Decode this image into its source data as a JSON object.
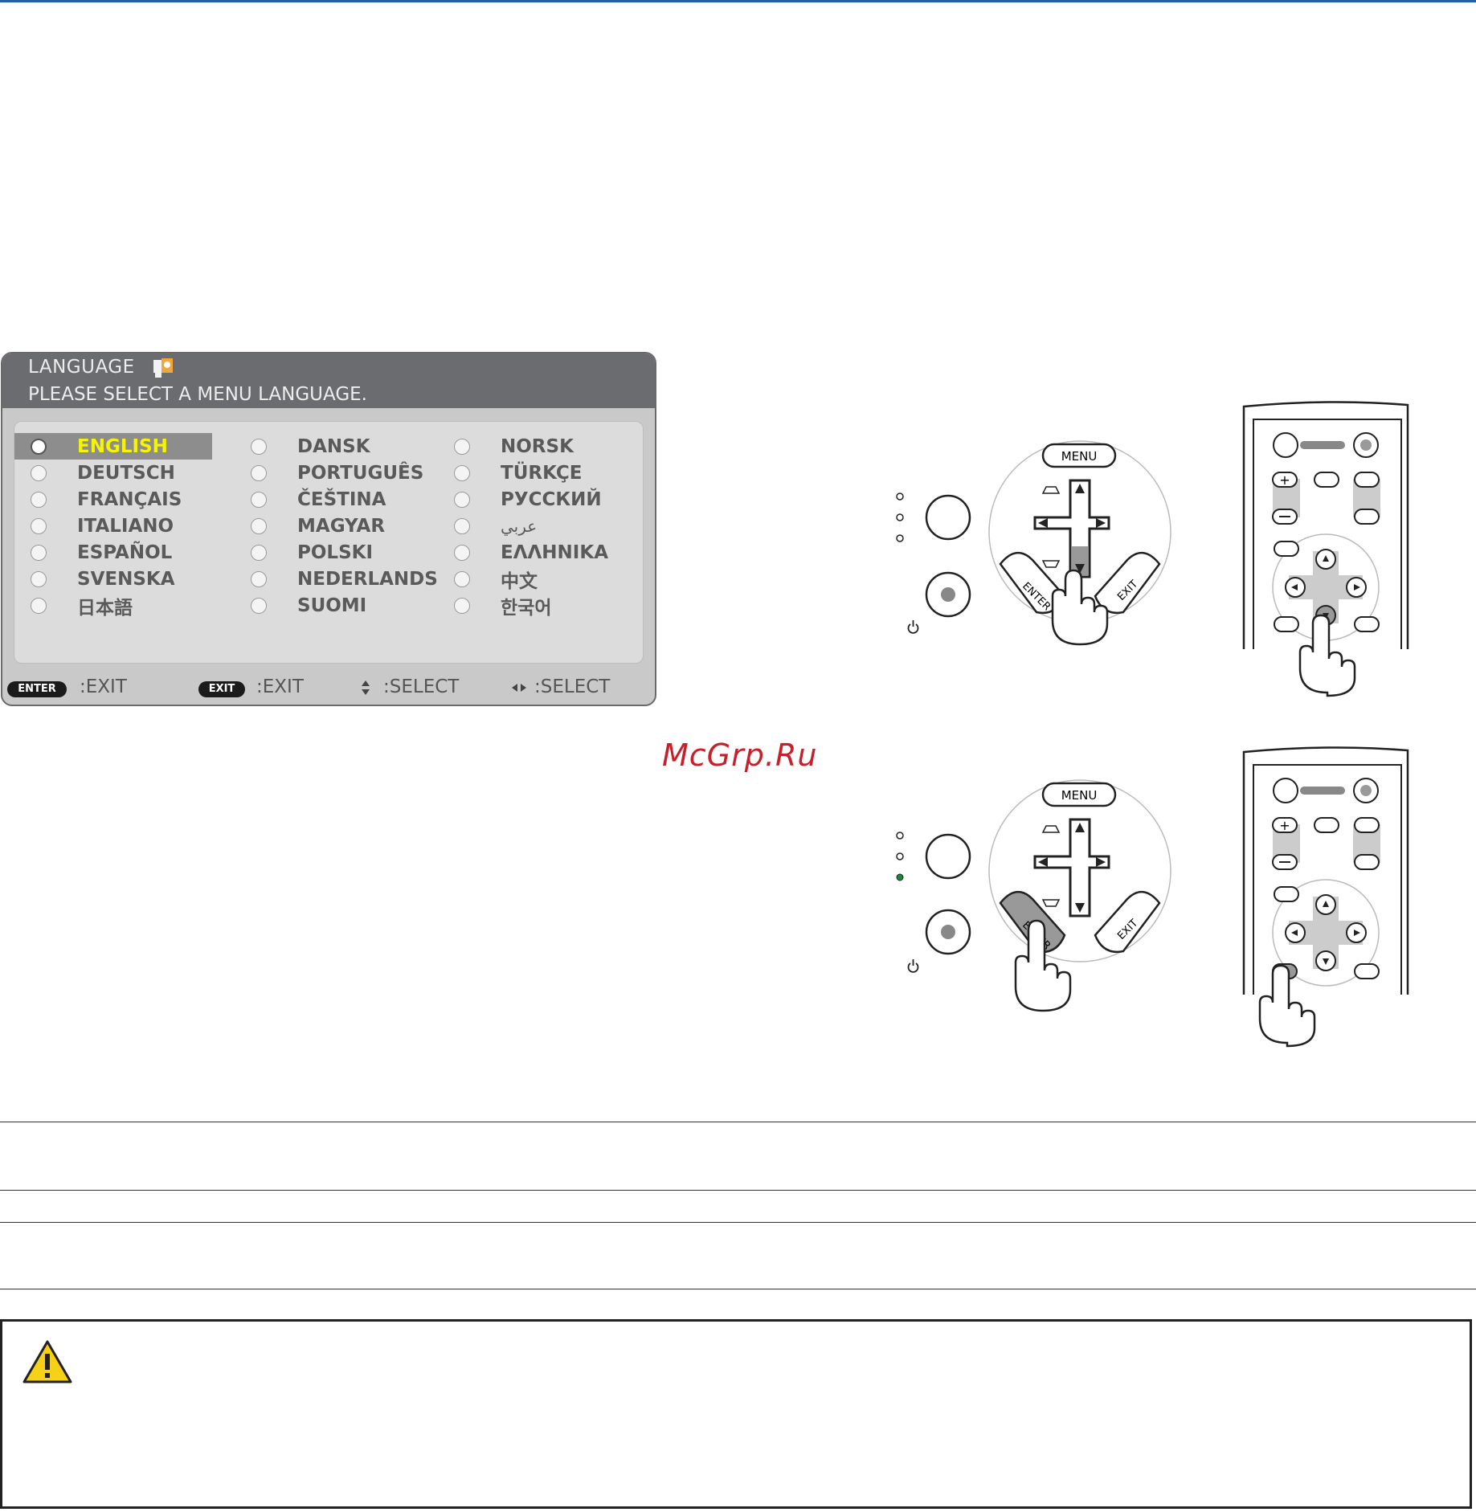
{
  "osd": {
    "title": "LANGUAGE",
    "subtitle": "PLEASE SELECT A MENU LANGUAGE.",
    "columns": [
      [
        "ENGLISH",
        "DEUTSCH",
        "FRANÇAIS",
        "ITALIANO",
        "ESPAÑOL",
        "SVENSKA",
        "日本語"
      ],
      [
        "DANSK",
        "PORTUGUÊS",
        "ČEŠTINA",
        "MAGYAR",
        "POLSKI",
        "NEDERLANDS",
        "SUOMI"
      ],
      [
        "NORSK",
        "TÜRKÇE",
        "РУССКИЙ",
        "عربي",
        "ΕΛΛΗΝΙΚΑ",
        "中文",
        "한국어"
      ]
    ],
    "selected": "ENGLISH",
    "footer": {
      "enter_key": "ENTER",
      "enter_action": ":EXIT",
      "exit_key": "EXIT",
      "exit_action": ":EXIT",
      "updown_action": ":SELECT",
      "leftright_action": ":SELECT"
    },
    "colors": {
      "header": "#6b6c70",
      "panel": "#dcdcdc",
      "selected_text": "#f5f500"
    }
  },
  "watermark": "McGrp.Ru",
  "illustrations": {
    "projector_buttons": {
      "menu": "MENU",
      "enter": "ENTER",
      "exit": "EXIT"
    }
  },
  "caution": {
    "icon": "warning-triangle-icon"
  }
}
